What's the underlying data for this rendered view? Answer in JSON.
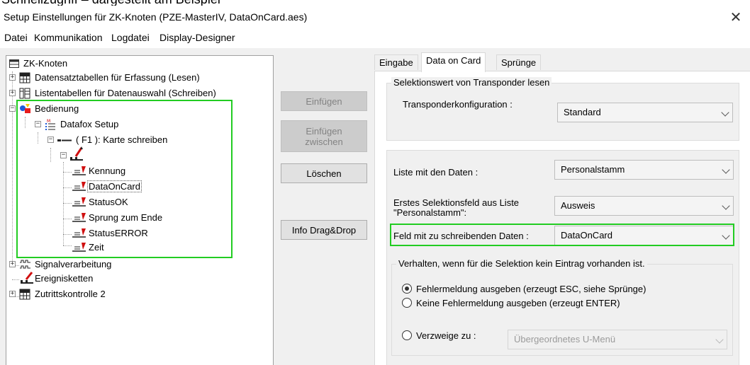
{
  "caption": "Schnellzugriff – dargestellt am Beispiel",
  "window": {
    "title": "Setup Einstellungen für ZK-Knoten     (PZE-MasterIV, DataOnCard.aes)",
    "close": "✕"
  },
  "menu": [
    "Datei",
    "Kommunikation",
    "Logdatei",
    "Display-Designer"
  ],
  "tree": {
    "root": "ZK-Knoten",
    "items": [
      "Datensatztabellen für Erfassung (Lesen)",
      "Listentabellen für Datenauswahl (Schreiben)",
      "Bedienung",
      "Datafox Setup",
      "( F1 ):  Karte schreiben",
      "Kennung",
      "DataOnCard",
      "StatusOK",
      "Sprung zum Ende",
      "StatusERROR",
      "Zeit",
      "Signalverarbeitung",
      "Ereignisketten",
      "Zutrittskontrolle 2"
    ],
    "selected": "DataOnCard"
  },
  "buttons": {
    "einfuegen": "Einfügen",
    "einfuegen_zwischen_1": "Einfügen",
    "einfuegen_zwischen_2": "zwischen",
    "loeschen": "Löschen",
    "info": "Info Drag&Drop"
  },
  "tabs": [
    "Eingabe",
    "Data on Card",
    "Sprünge"
  ],
  "active_tab": "Data on Card",
  "form": {
    "group1_title": "Selektionswert von Transponder lesen",
    "transponder_label": "Transponderkonfiguration :",
    "transponder_value": "Standard",
    "liste_label": "Liste mit den Daten :",
    "liste_value": "Personalstamm",
    "erstes_label_1": "Erstes Selektionsfeld aus Liste",
    "erstes_label_2": "\"Personalstamm\":",
    "erstes_value": "Ausweis",
    "feld_label": "Feld mit zu schreibenden Daten :",
    "feld_value": "DataOnCard",
    "group2_title": "Verhalten, wenn für die Selektion kein Eintrag vorhanden ist.",
    "radio1": "Fehlermeldung ausgeben (erzeugt ESC, siehe Sprünge)",
    "radio2": "Keine Fehlermeldung ausgeben (erzeugt ENTER)",
    "radio3": "Verzweige zu :",
    "verzweige_value": "Übergeordnetes U-Menü",
    "selected_radio": 1
  },
  "colors": {
    "highlight": "#22cc22",
    "background": "#f0f0f0"
  }
}
